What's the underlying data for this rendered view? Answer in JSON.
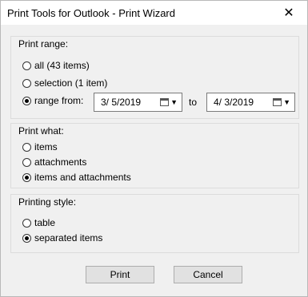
{
  "window": {
    "title": "Print Tools for Outlook - Print Wizard",
    "close_glyph": "✕"
  },
  "print_range": {
    "label": "Print range:",
    "options": [
      {
        "label": "all (43 items)",
        "checked": false
      },
      {
        "label": "selection (1 item)",
        "checked": false
      },
      {
        "label": "range from:",
        "checked": true
      }
    ],
    "from_date": "3/  5/2019",
    "to_label": "to",
    "to_date": "4/  3/2019"
  },
  "print_what": {
    "label": "Print what:",
    "options": [
      {
        "label": "items",
        "checked": false
      },
      {
        "label": "attachments",
        "checked": false
      },
      {
        "label": "items and attachments",
        "checked": true
      }
    ]
  },
  "printing_style": {
    "label": "Printing style:",
    "options": [
      {
        "label": "table",
        "checked": false
      },
      {
        "label": "separated items",
        "checked": true
      }
    ]
  },
  "buttons": {
    "print": "Print",
    "cancel": "Cancel"
  }
}
